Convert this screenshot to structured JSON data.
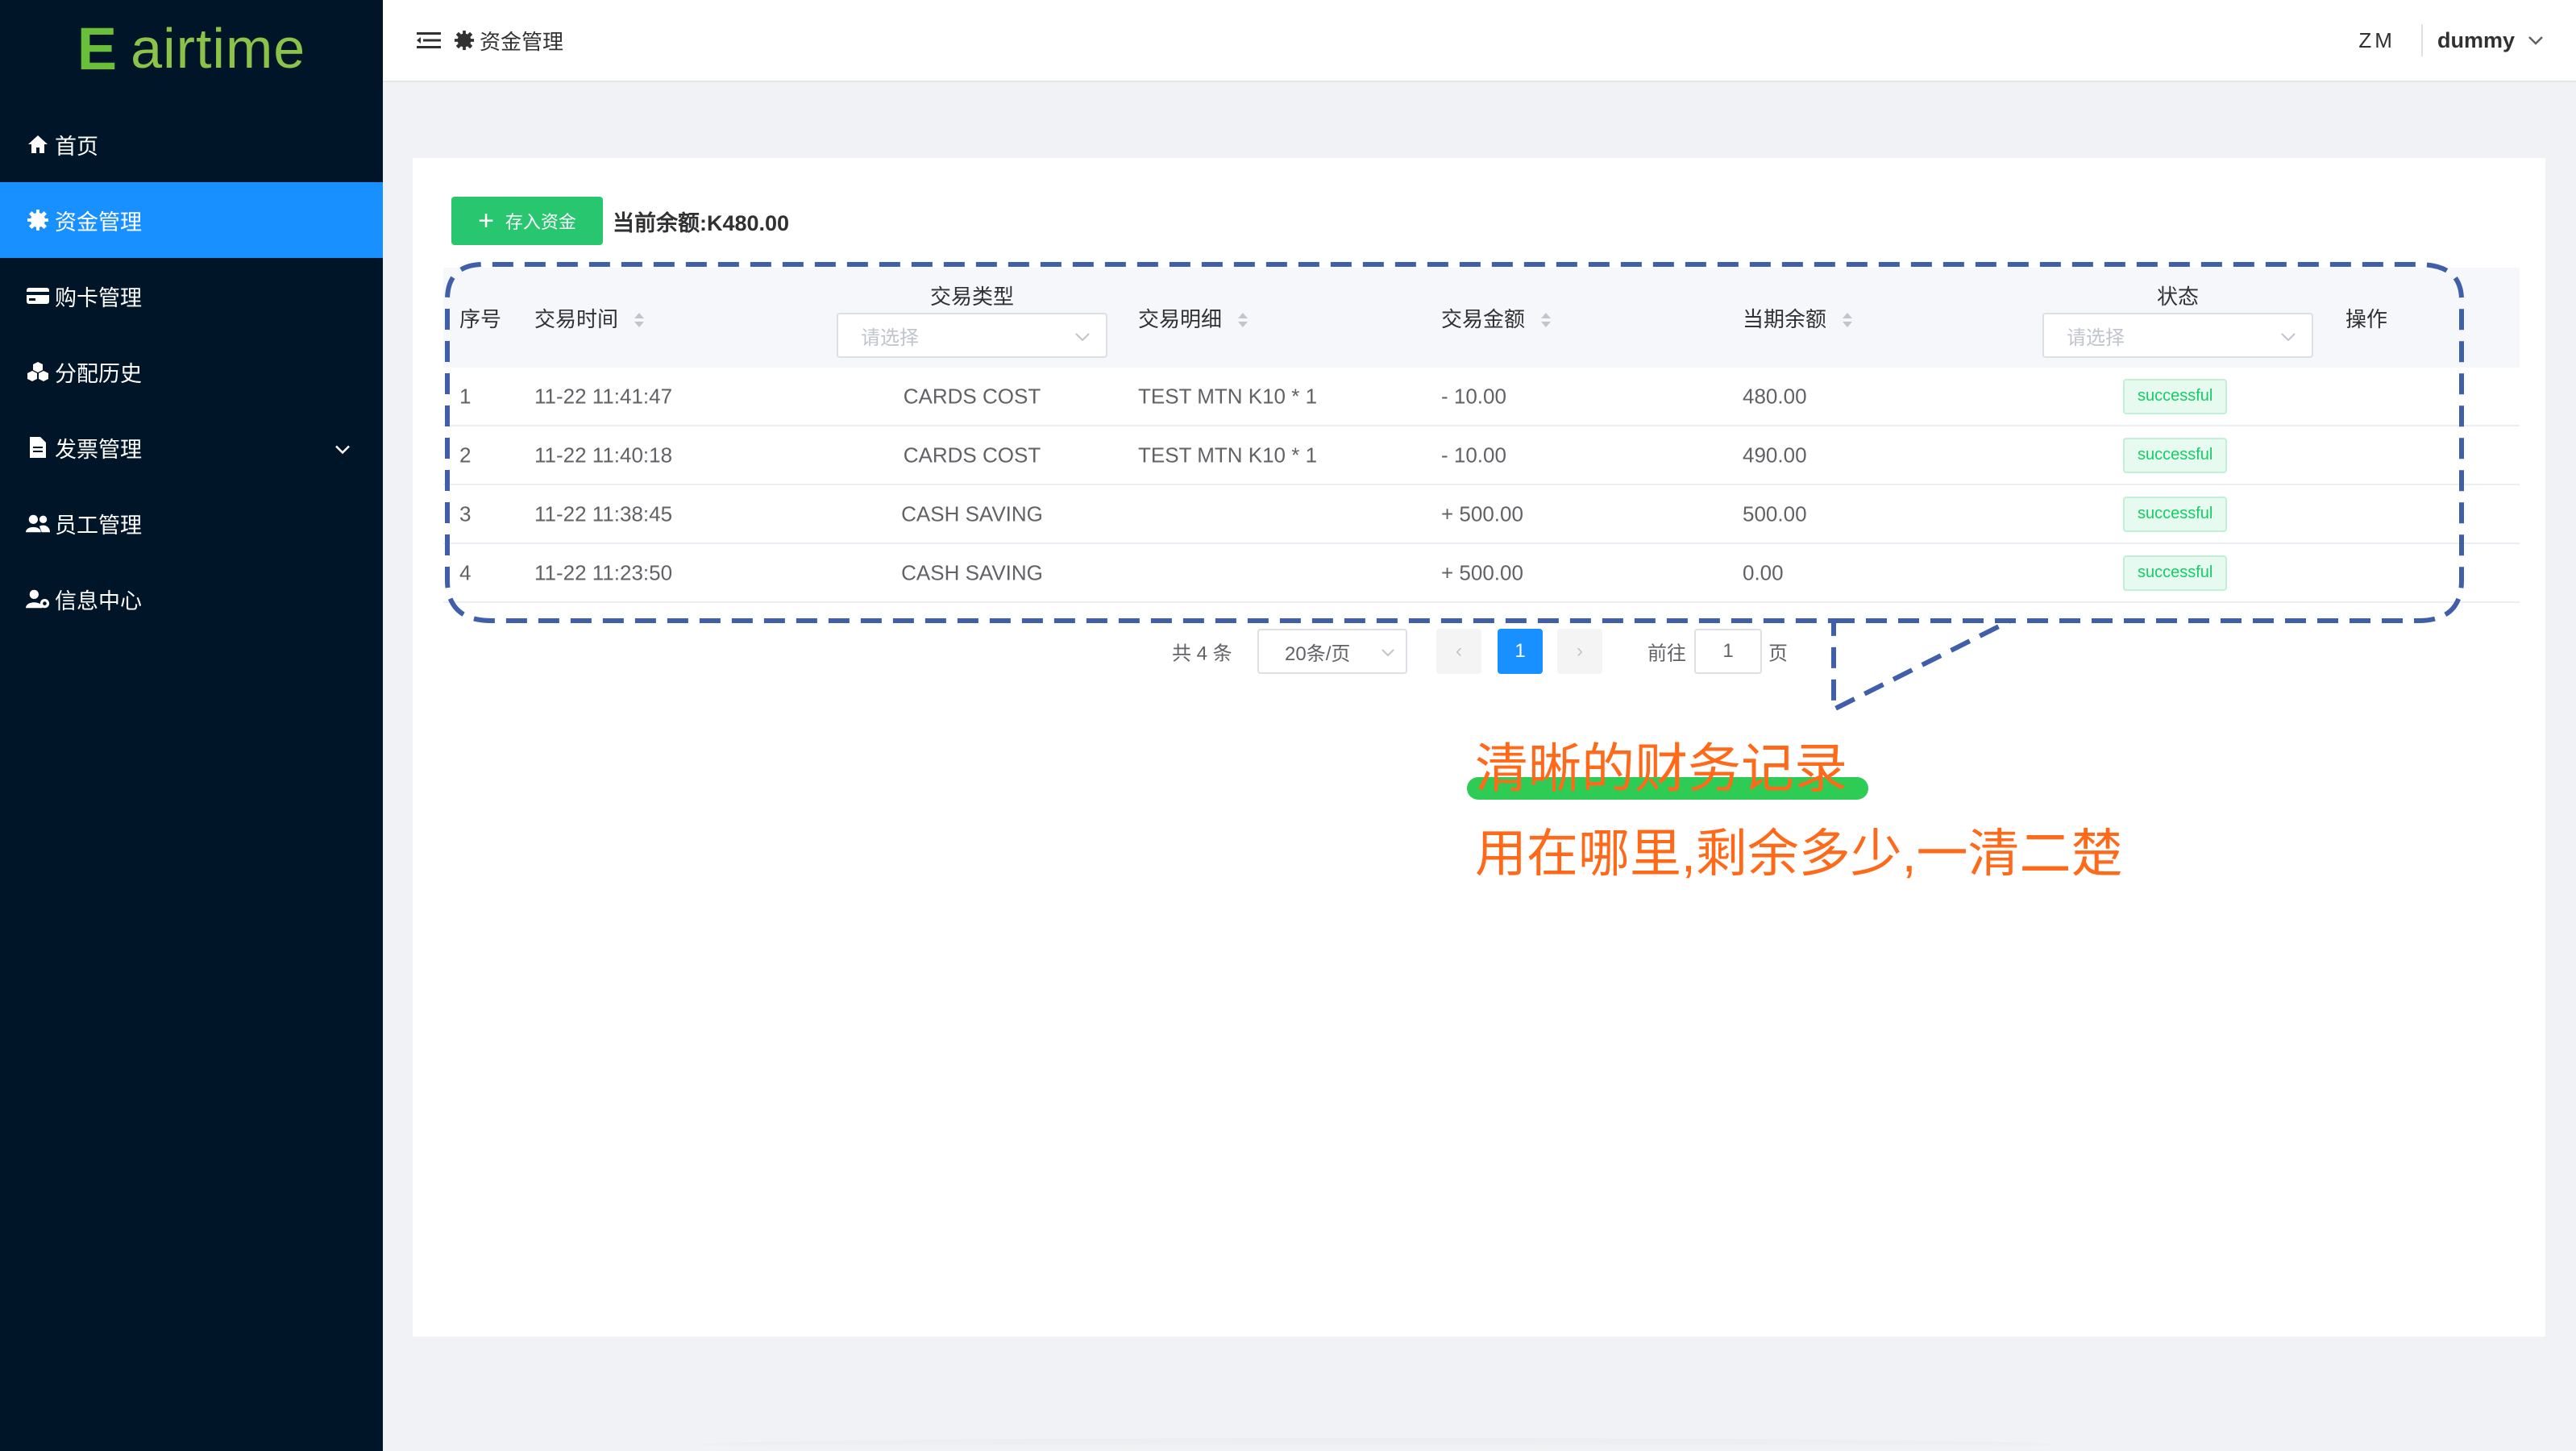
{
  "app": {
    "logo_letter": "E",
    "logo_text": "airtime"
  },
  "sidebar": {
    "items": [
      {
        "label": "首页",
        "icon": "home-icon"
      },
      {
        "label": "资金管理",
        "icon": "gear-icon",
        "active": true
      },
      {
        "label": "购卡管理",
        "icon": "card-icon"
      },
      {
        "label": "分配历史",
        "icon": "cubes-icon"
      },
      {
        "label": "发票管理",
        "icon": "file-icon",
        "has_children": true
      },
      {
        "label": "员工管理",
        "icon": "users-icon"
      },
      {
        "label": "信息中心",
        "icon": "user-gear-icon"
      }
    ]
  },
  "header": {
    "breadcrumb": "资金管理",
    "language": "ZM",
    "user": "dummy"
  },
  "toolbar": {
    "deposit_label": "存入资金",
    "balance": "当前余额:K480.00"
  },
  "table": {
    "columns": {
      "index": "序号",
      "time": "交易时间",
      "type": "交易类型",
      "type_placeholder": "请选择",
      "detail": "交易明细",
      "amount": "交易金额",
      "balance": "当期余额",
      "status": "状态",
      "status_placeholder": "请选择",
      "actions": "操作"
    },
    "rows": [
      {
        "index": "1",
        "time": "11-22 11:41:47",
        "type": "CARDS COST",
        "detail": "TEST MTN K10 * 1",
        "amount": "- 10.00",
        "balance": "480.00",
        "status": "successful"
      },
      {
        "index": "2",
        "time": "11-22 11:40:18",
        "type": "CARDS COST",
        "detail": "TEST MTN K10 * 1",
        "amount": "- 10.00",
        "balance": "490.00",
        "status": "successful"
      },
      {
        "index": "3",
        "time": "11-22 11:38:45",
        "type": "CASH SAVING",
        "detail": "",
        "amount": "+ 500.00",
        "balance": "500.00",
        "status": "successful"
      },
      {
        "index": "4",
        "time": "11-22 11:23:50",
        "type": "CASH SAVING",
        "detail": "",
        "amount": "+ 500.00",
        "balance": "0.00",
        "status": "successful"
      }
    ]
  },
  "pagination": {
    "total": "共 4 条",
    "page_size": "20条/页",
    "prev": "‹",
    "current": "1",
    "next": "›",
    "goto_label": "前往",
    "goto_value": "1",
    "page_suffix": "页"
  },
  "annotation": {
    "title": "清晰的财务记录",
    "subtitle": "用在哪里,剩余多少,一清二楚"
  },
  "colors": {
    "sidebar_bg": "#001528",
    "accent": "#1890ff",
    "deposit_button": "#28c76f",
    "annotation_text": "#ff6a1a",
    "annotation_highlight": "#2ecc55",
    "dashed_outline": "#3f5fa8"
  }
}
